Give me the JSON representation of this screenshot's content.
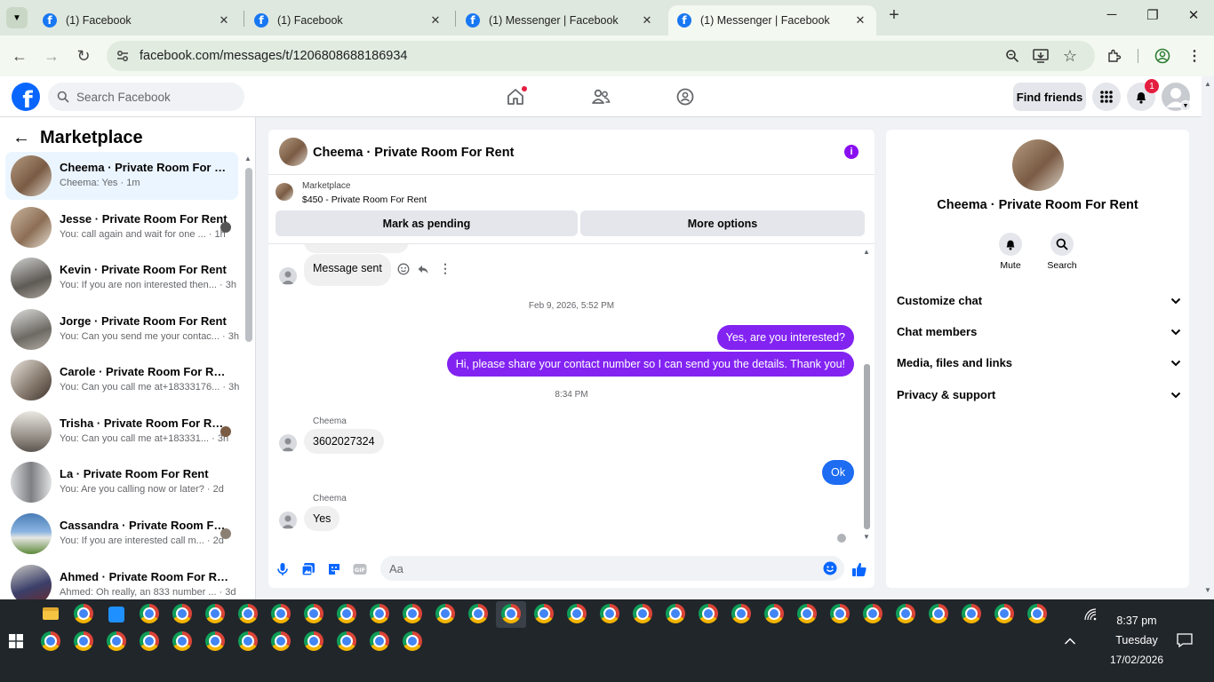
{
  "browser": {
    "tabs": [
      {
        "title": "(1) Facebook"
      },
      {
        "title": "(1) Facebook"
      },
      {
        "title": "(1) Messenger | Facebook"
      },
      {
        "title": "(1) Messenger | Facebook",
        "active": true
      }
    ],
    "close_glyph": "✕",
    "new_tab_glyph": "+",
    "url": "facebook.com/messages/t/1206808688186934"
  },
  "fb": {
    "logo_letter": "f",
    "search_placeholder": "Search Facebook",
    "find_friends": "Find friends",
    "notification_count": "1"
  },
  "sidebar": {
    "title": "Marketplace",
    "conversations": [
      {
        "name": "Cheema · Private Room For Rent",
        "snippet": "Cheema: Yes · 1m",
        "active": true,
        "color": "#7a5b44"
      },
      {
        "name": "Jesse · Private Room For Rent",
        "snippet": "You: call again and wait for one ... · 1h",
        "color": "#8c6e55"
      },
      {
        "name": "Kevin · Private Room For Rent",
        "snippet": "You: If you are non interested then... · 3h",
        "color": "#5e5a55"
      },
      {
        "name": "Jorge · Private Room For Rent",
        "snippet": "You: Can you send me your contac... · 3h",
        "color": "#6d6a64"
      },
      {
        "name": "Carole · Private Room For Rent",
        "snippet": "You: Can you call me at+18333176... · 3h",
        "color": "#8a7e72"
      },
      {
        "name": "Trisha · Private Room For Rent",
        "snippet": "You: Can you call me at+183331... · 3h",
        "color": "#9a948c"
      },
      {
        "name": "La · Private Room For Rent",
        "snippet": "You: Are you calling now or later? · 2d",
        "color": "#7d7f82"
      },
      {
        "name": "Cassandra · Private Room For...",
        "snippet": "You: If you are interested call m... · 2d",
        "color": "#4a7db8"
      },
      {
        "name": "Ahmed · Private Room For Rent",
        "snippet": "Ahmed: Oh really, an 833 number ... · 3d",
        "color": "#3b3f6a"
      }
    ]
  },
  "chat": {
    "title": "Cheema · Private Room For Rent",
    "info_glyph": "i",
    "marketplace_label": "Marketplace",
    "listing": "$450 - Private Room For Rent",
    "mark_pending": "Mark as pending",
    "more_options": "More options",
    "message_sent": "Message sent",
    "timestamp1": "Feb 9, 2026, 5:52 PM",
    "out1": "Yes, are you interested?",
    "out2": "Hi, please share your contact number so I can send you the details. Thank you!",
    "timestamp2": "8:34 PM",
    "sender": "Cheema",
    "in1": "3602027324",
    "out3": "Ok",
    "in2": "Yes",
    "input_placeholder": "Aa"
  },
  "info": {
    "name": "Cheema · Private Room For Rent",
    "mute": "Mute",
    "search": "Search",
    "sections": [
      "Customize chat",
      "Chat members",
      "Media, files and links",
      "Privacy & support"
    ]
  },
  "taskbar": {
    "time": "8:37 pm",
    "day": "Tuesday",
    "date": "17/02/2026"
  }
}
